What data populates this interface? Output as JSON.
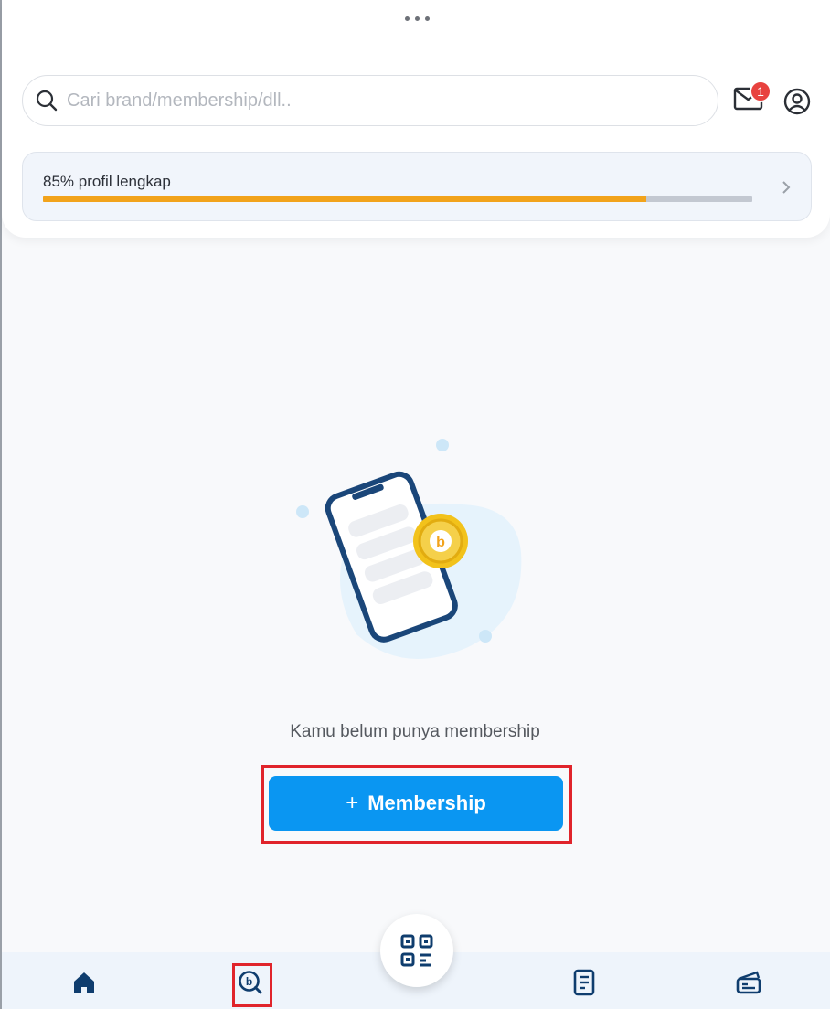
{
  "search": {
    "placeholder": "Cari brand/membership/dll.."
  },
  "header": {
    "mail_badge": "1"
  },
  "profile": {
    "text": "85% profil lengkap",
    "progress_fraction": 0.85
  },
  "empty_state": {
    "message": "Kamu belum punya membership"
  },
  "membership_button": {
    "icon": "+",
    "label": "Membership"
  },
  "icons": {
    "search": "search-icon",
    "mail": "mail-icon",
    "user": "user-icon",
    "chevron": "chevron-right-icon",
    "home": "home-icon",
    "explore": "explore-icon",
    "scan": "qr-scan-icon",
    "receipt": "receipt-icon",
    "voucher": "voucher-icon",
    "coin": "coin-icon"
  },
  "colors": {
    "accent": "#0a96f2",
    "progress": "#f2a31b",
    "badge": "#e8423f",
    "nav_icon": "#0f3d6e",
    "highlight": "#e0242b"
  }
}
